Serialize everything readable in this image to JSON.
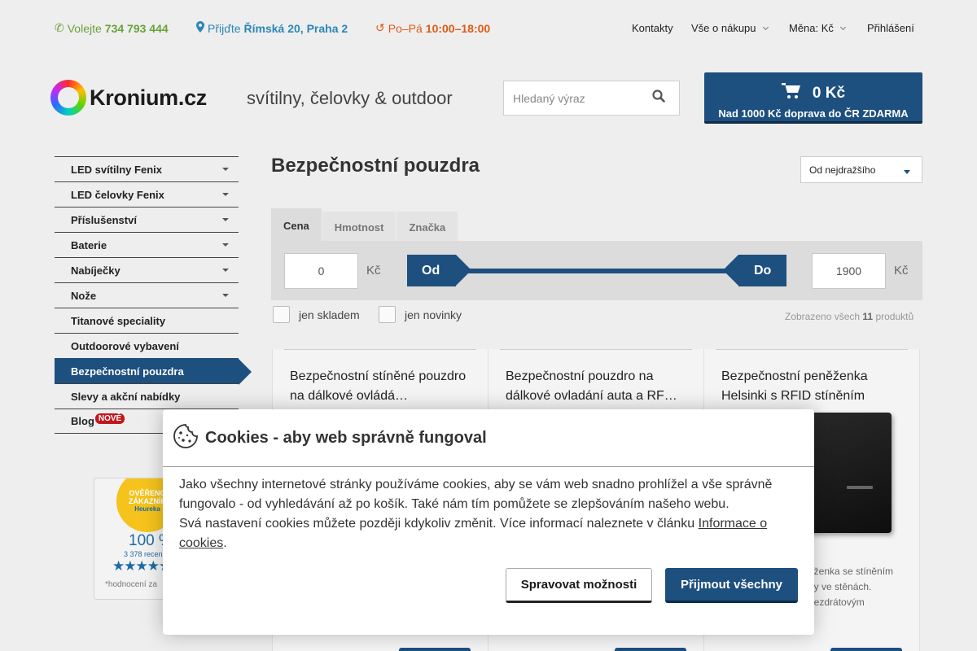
{
  "topbar": {
    "phone_prefix": "Volejte",
    "phone": "734 793 444",
    "address_prefix": "Přijďte",
    "address": "Římská 20, Praha 2",
    "hours_prefix": "Po–Pá",
    "hours": "10:00–18:00",
    "links": {
      "contacts": "Kontakty",
      "shopping": "Vše o nákupu",
      "currency": "Měna: Kč",
      "login": "Přihlášení"
    },
    "colors": {
      "phone": "#6aa23a",
      "address": "#2b86b8",
      "hours": "#e05a17"
    }
  },
  "header": {
    "logo_text": "Kronium.cz",
    "tagline": "svítilny, čelovky & outdoor",
    "search_placeholder": "Hledaný výraz",
    "cart_amount": "0 Kč",
    "cart_shipping": "Nad 1000 Kč doprava do ČR ZDARMA"
  },
  "sidebar": {
    "items": [
      {
        "label": "LED svítilny Fenix",
        "has_submenu": true
      },
      {
        "label": "LED čelovky Fenix",
        "has_submenu": true
      },
      {
        "label": "Příslušenství",
        "has_submenu": true
      },
      {
        "label": "Baterie",
        "has_submenu": true
      },
      {
        "label": "Nabíječky",
        "has_submenu": true
      },
      {
        "label": "Nože",
        "has_submenu": true
      },
      {
        "label": "Titanové speciality",
        "has_submenu": false
      },
      {
        "label": "Outdoorové vybavení",
        "has_submenu": false
      },
      {
        "label": "Bezpečnostní pouzdra",
        "has_submenu": false,
        "active": true
      },
      {
        "label": "Slevy a akční nabídky",
        "has_submenu": false
      },
      {
        "label": "Blog",
        "badge": "NOVĚ"
      }
    ],
    "heureka": {
      "seal_line1": "OVĚŘENO",
      "seal_line2": "ZÁKAZNÍK",
      "seal_brand": "Heureka",
      "percent": "100 %",
      "reviews": "3 378 recenzí",
      "stars": "★★★★★",
      "note": "*hodnocení za"
    }
  },
  "main": {
    "title": "Bezpečnostní pouzdra",
    "sort_selected": "Od nejdražšího",
    "filter_tabs": [
      "Cena",
      "Hmotnost",
      "Značka"
    ],
    "active_tab": "Cena",
    "price": {
      "min": "0",
      "max": "1900",
      "currency": "Kč",
      "from_label": "Od",
      "to_label": "Do"
    },
    "checkboxes": {
      "in_stock": "jen skladem",
      "new_only": "jen novinky"
    },
    "shown": {
      "prefix": "Zobrazeno všech",
      "count": "11",
      "suffix": "produktů"
    },
    "products": [
      {
        "title": "Bezpečnostní stíněné pouzdro na dálkové ovládá…",
        "desc": ""
      },
      {
        "title": "Bezpečnostní pouzdro na dálkové ovladání auta a RF…",
        "desc": ""
      },
      {
        "title": "Bezpečnostní peněženka Helsinki s RFID stíněním",
        "desc_lines": [
          "ěženka se stíněním",
          "oy ve stěnách.",
          "bezdrátovým"
        ]
      }
    ]
  },
  "cookie": {
    "title": "Cookies - aby web správně fungoval",
    "text1": "Jako všechny internetové stránky používáme cookies, aby se vám web snadno prohlížel a vše správně fungovalo - od vyhledávání až po košík. Také nám tím pomůžete se zlepšováním našeho webu.",
    "text2": "Svá nastavení cookies můžete později kdykoliv změnit. Více informací naleznete v článku ",
    "link": "Informace o cookies",
    "text_end": ".",
    "btn_manage": "Spravovat možnosti",
    "btn_accept": "Přijmout všechny"
  }
}
